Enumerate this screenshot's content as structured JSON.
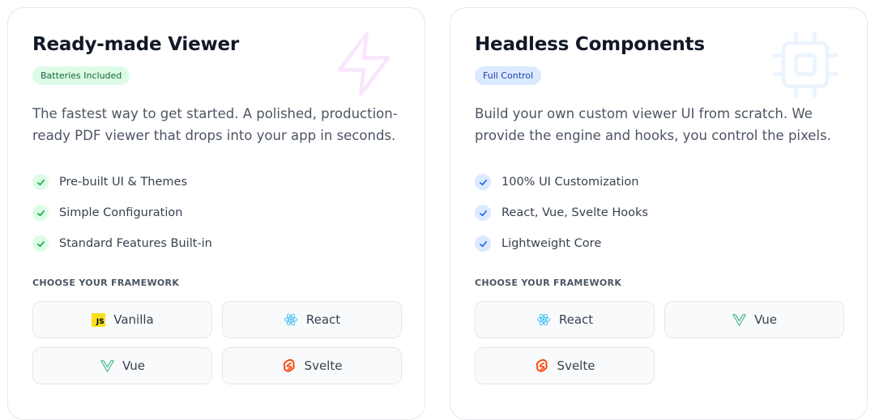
{
  "cards": [
    {
      "title": "Ready-made Viewer",
      "badge": "Batteries Included",
      "accent": "#22c55e",
      "deco_icon": "lightning-bolt-icon",
      "description": "The fastest way to get started. A polished, production-ready PDF viewer that drops into your app in seconds.",
      "features": [
        "Pre-built UI & Themes",
        "Simple Configuration",
        "Standard Features Built-in"
      ],
      "framework_label": "CHOOSE YOUR FRAMEWORK",
      "frameworks": [
        {
          "label": "Vanilla",
          "icon": "javascript-icon"
        },
        {
          "label": "React",
          "icon": "react-icon"
        },
        {
          "label": "Vue",
          "icon": "vue-icon"
        },
        {
          "label": "Svelte",
          "icon": "svelte-icon"
        }
      ]
    },
    {
      "title": "Headless Components",
      "badge": "Full Control",
      "accent": "#3b82f6",
      "deco_icon": "cpu-chip-icon",
      "description": "Build your own custom viewer UI from scratch. We provide the engine and hooks, you control the pixels.",
      "features": [
        "100% UI Customization",
        "React, Vue, Svelte Hooks",
        "Lightweight Core"
      ],
      "framework_label": "CHOOSE YOUR FRAMEWORK",
      "frameworks": [
        {
          "label": "React",
          "icon": "react-icon"
        },
        {
          "label": "Vue",
          "icon": "vue-icon"
        },
        {
          "label": "Svelte",
          "icon": "svelte-icon"
        }
      ]
    }
  ],
  "icons": {
    "js_text": "JS"
  },
  "colors": {
    "react": "#38bdf8",
    "vue": "#42b883",
    "svelte": "#ff3e00",
    "js": "#f7df1e"
  }
}
